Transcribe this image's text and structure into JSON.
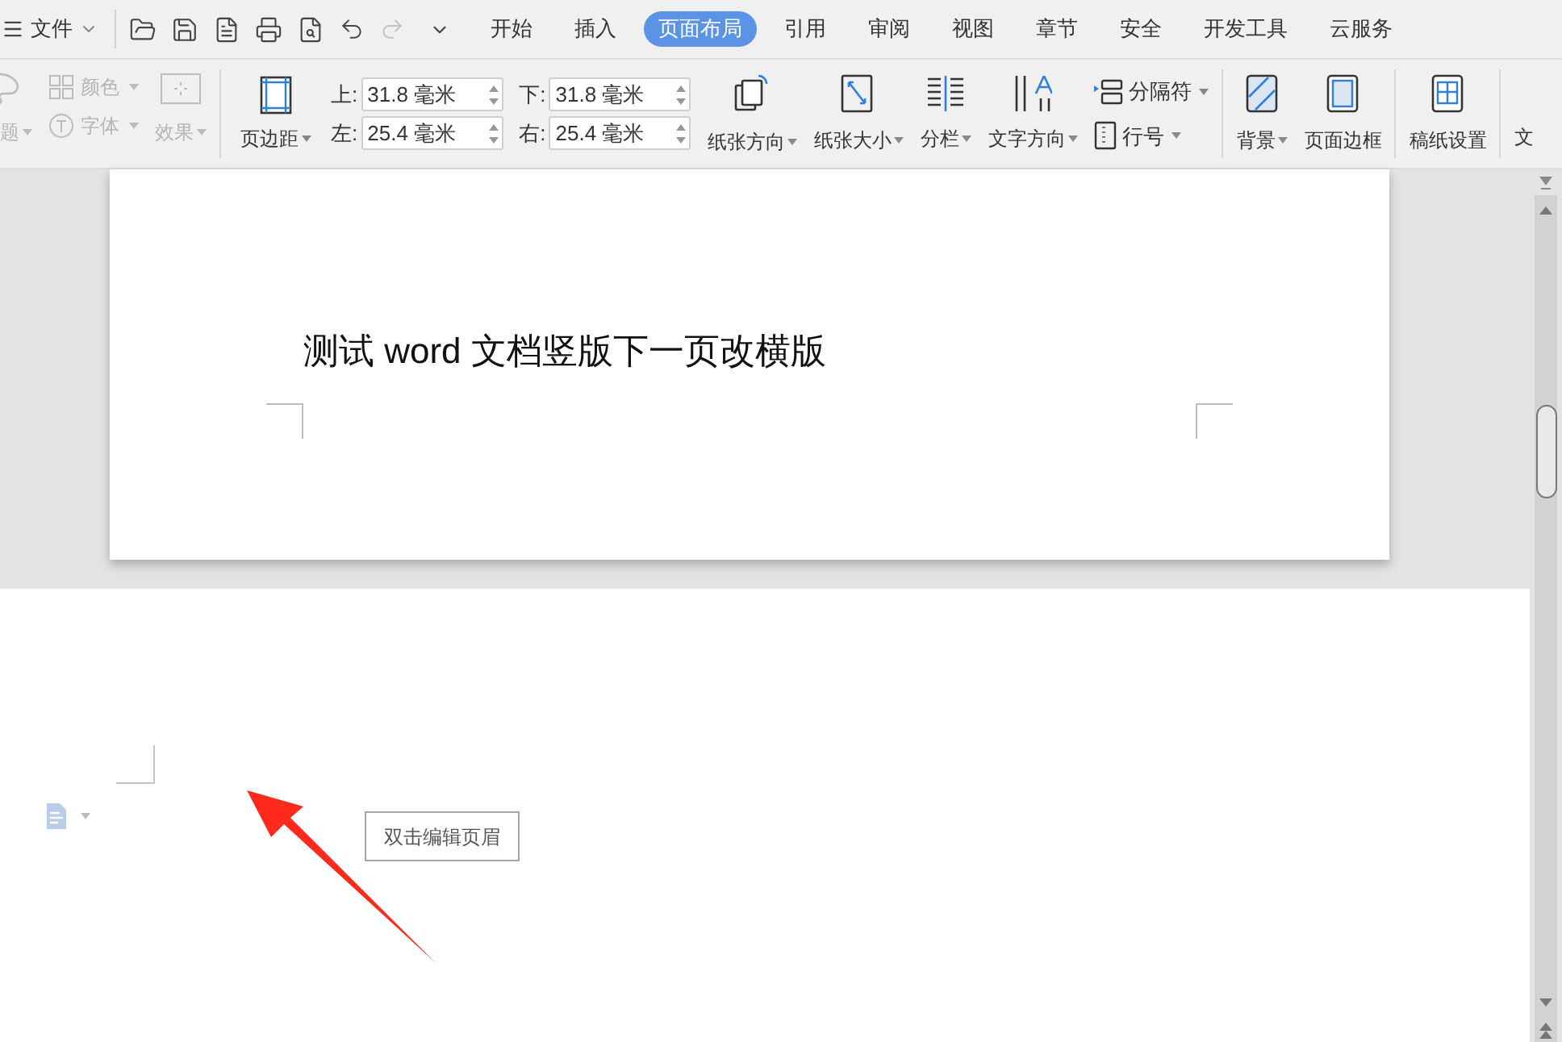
{
  "menu_bar": {
    "file_menu": "文件",
    "tabs": [
      {
        "label": "开始",
        "selected": false
      },
      {
        "label": "插入",
        "selected": false
      },
      {
        "label": "页面布局",
        "selected": true
      },
      {
        "label": "引用",
        "selected": false
      },
      {
        "label": "审阅",
        "selected": false
      },
      {
        "label": "视图",
        "selected": false
      },
      {
        "label": "章节",
        "selected": false
      },
      {
        "label": "安全",
        "selected": false
      },
      {
        "label": "开发工具",
        "selected": false
      },
      {
        "label": "云服务",
        "selected": false
      }
    ]
  },
  "ribbon": {
    "theme_group": [
      {
        "label": "题",
        "disabled": true
      },
      {
        "label": "颜色",
        "disabled": true
      },
      {
        "label": "字体",
        "disabled": true
      },
      {
        "label": "效果",
        "disabled": true
      }
    ],
    "margins_button": "页边距",
    "margin_fields": [
      {
        "label": "上:",
        "value": "31.8 毫米"
      },
      {
        "label": "下:",
        "value": "31.8 毫米"
      },
      {
        "label": "左:",
        "value": "25.4 毫米"
      },
      {
        "label": "右:",
        "value": "25.4 毫米"
      }
    ],
    "layout_buttons": [
      {
        "label": "纸张方向",
        "dropdown": true
      },
      {
        "label": "纸张大小",
        "dropdown": true
      },
      {
        "label": "分栏",
        "dropdown": true
      },
      {
        "label": "文字方向",
        "dropdown": true
      }
    ],
    "small_buttons": [
      {
        "label": "分隔符",
        "dropdown": true
      },
      {
        "label": "行号",
        "dropdown": true
      }
    ],
    "page_buttons": [
      {
        "label": "背景",
        "dropdown": true
      },
      {
        "label": "页面边框",
        "dropdown": false
      }
    ],
    "grid_button": "稿纸设置",
    "cut_button": "文"
  },
  "document": {
    "page_text": "测试 word 文档竖版下一页改横版",
    "header_tooltip": "双击编辑页眉"
  }
}
